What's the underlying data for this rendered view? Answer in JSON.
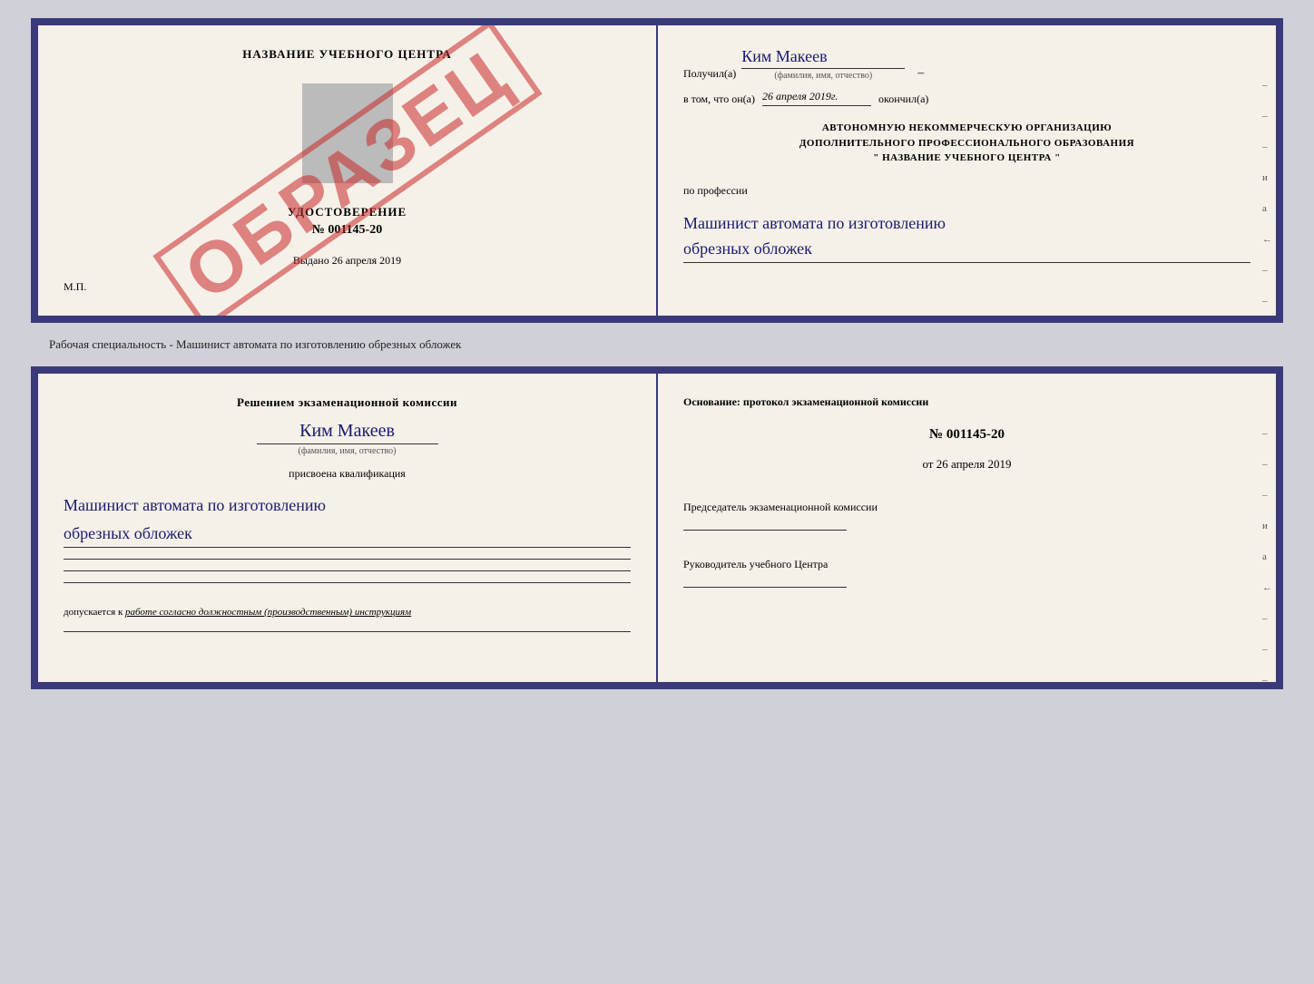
{
  "top_card": {
    "left": {
      "school_name": "НАЗВАНИЕ УЧЕБНОГО ЦЕНТРА",
      "cert_label": "УДОСТОВЕРЕНИЕ",
      "cert_number": "№ 001145-20",
      "vydano_label": "Выдано",
      "vydano_date": "26 апреля 2019",
      "mp_label": "М.П.",
      "stamp_text": "ОБРАЗЕЦ"
    },
    "right": {
      "poluchil_label": "Получил(а)",
      "poluchil_name": "Ким Макеев",
      "fio_sub": "(фамилия, имя, отчество)",
      "vtom_label": "в том, что он(а)",
      "vtom_date": "26 апреля 2019г.",
      "okonchil_label": "окончил(а)",
      "org_line1": "АВТОНОМНУЮ НЕКОММЕРЧЕСКУЮ ОРГАНИЗАЦИЮ",
      "org_line2": "ДОПОЛНИТЕЛЬНОГО ПРОФЕССИОНАЛЬНОГО ОБРАЗОВАНИЯ",
      "org_line3": "\"  НАЗВАНИЕ УЧЕБНОГО ЦЕНТРА  \"",
      "po_professii_label": "по профессии",
      "profession_line1": "Машинист автомата по изготовлению",
      "profession_line2": "обрезных обложек",
      "side_marks": [
        "-",
        "-",
        "-",
        "и",
        "а",
        "←",
        "-",
        "-",
        "-",
        "-",
        "-"
      ]
    }
  },
  "middle": {
    "text": "Рабочая специальность - Машинист автомата по изготовлению обрезных обложек"
  },
  "bottom_card": {
    "left": {
      "resheniem_label": "Решением экзаменационной комиссии",
      "name": "Ким Макеев",
      "fio_sub": "(фамилия, имя, отчество)",
      "prisvoena_label": "присвоена квалификация",
      "qualification_line1": "Машинист автомата по изготовлению",
      "qualification_line2": "обрезных обложек",
      "dopuskaetsya_label": "допускается к",
      "dopuskaetsya_text": "работе согласно должностным (производственным) инструкциям"
    },
    "right": {
      "osnov_label": "Основание: протокол экзаменационной комиссии",
      "protokol_number": "№  001145-20",
      "ot_label": "от",
      "ot_date": "26 апреля 2019",
      "predsedatel_label": "Председатель экзаменационной комиссии",
      "rukov_label": "Руководитель учебного Центра",
      "side_marks": [
        "-",
        "-",
        "-",
        "и",
        "а",
        "←",
        "-",
        "-",
        "-",
        "-",
        "-"
      ]
    }
  }
}
